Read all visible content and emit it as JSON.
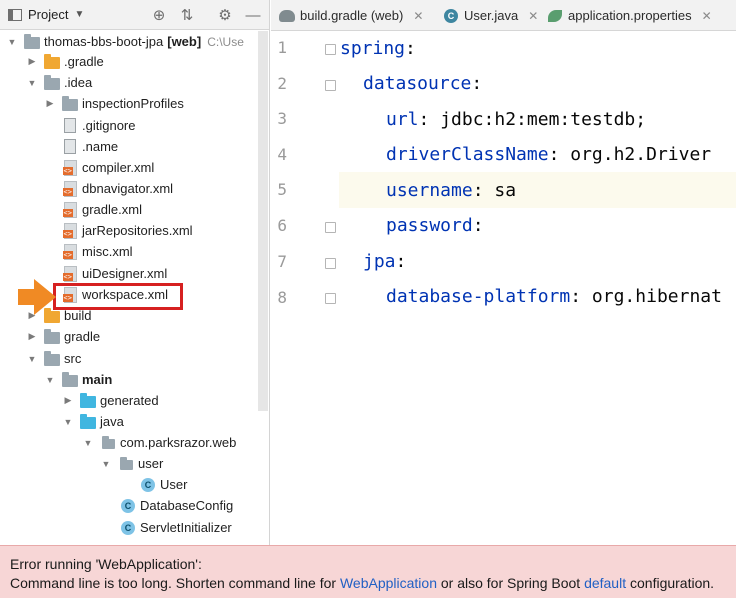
{
  "project_panel": {
    "title": "Project",
    "icons": [
      "project-view-icon",
      "dropdown-caret-icon",
      "locate-icon",
      "collapse-all-icon",
      "gear-icon",
      "hide-icon"
    ],
    "tree": [
      {
        "label": "thomas-bbs-boot-jpa",
        "tag": "[web]",
        "hint": "C:\\Use",
        "icon": "folder-module-icon",
        "expanded": true
      },
      {
        "label": ".gradle",
        "icon": "folder-orange-icon",
        "expanded": false
      },
      {
        "label": ".idea",
        "icon": "folder-icon",
        "expanded": true
      },
      {
        "label": "inspectionProfiles",
        "icon": "folder-icon",
        "expanded": false
      },
      {
        "label": ".gitignore",
        "icon": "ignore-file-icon"
      },
      {
        "label": ".name",
        "icon": "text-file-icon"
      },
      {
        "label": "compiler.xml",
        "icon": "xml-file-icon"
      },
      {
        "label": "dbnavigator.xml",
        "icon": "xml-file-icon"
      },
      {
        "label": "gradle.xml",
        "icon": "xml-file-icon"
      },
      {
        "label": "jarRepositories.xml",
        "icon": "xml-file-icon"
      },
      {
        "label": "misc.xml",
        "icon": "xml-file-icon"
      },
      {
        "label": "uiDesigner.xml",
        "icon": "xml-file-icon"
      },
      {
        "label": "workspace.xml",
        "icon": "xml-file-icon",
        "highlighted": true
      },
      {
        "label": "build",
        "icon": "folder-orange-icon",
        "expanded": false
      },
      {
        "label": "gradle",
        "icon": "folder-icon",
        "expanded": false
      },
      {
        "label": "src",
        "icon": "folder-icon",
        "expanded": true
      },
      {
        "label": "main",
        "icon": "folder-source-root-icon",
        "expanded": true,
        "bold": true
      },
      {
        "label": "generated",
        "icon": "folder-blue-icon",
        "expanded": false
      },
      {
        "label": "java",
        "icon": "folder-blue-icon",
        "expanded": true
      },
      {
        "label": "com.parksrazor.web",
        "icon": "package-icon",
        "expanded": true
      },
      {
        "label": "user",
        "icon": "package-icon",
        "expanded": true
      },
      {
        "label": "User",
        "icon": "class-icon"
      },
      {
        "label": "DatabaseConfig",
        "icon": "class-icon"
      },
      {
        "label": "ServletInitializer",
        "icon": "class-icon"
      }
    ]
  },
  "editor": {
    "tabs": [
      {
        "label": "build.gradle (web)",
        "icon": "gradle-icon"
      },
      {
        "label": "User.java",
        "icon": "class-icon"
      },
      {
        "label": "application.properties",
        "icon": "leaf-icon"
      }
    ],
    "line_numbers": [
      "1",
      "2",
      "3",
      "4",
      "5",
      "6",
      "7",
      "8"
    ],
    "lines": [
      {
        "key": "spring",
        "sep": ":",
        "value": ""
      },
      {
        "key": "datasource",
        "sep": ":",
        "value": ""
      },
      {
        "key": "url",
        "sep": ": ",
        "value": "jdbc:h2:mem:testdb;"
      },
      {
        "key": "driverClassName",
        "sep": ": ",
        "value": "org.h2.Driver"
      },
      {
        "key": "username",
        "sep": ": ",
        "value": "sa"
      },
      {
        "key": "password",
        "sep": ":",
        "value": ""
      },
      {
        "key": "jpa",
        "sep": ":",
        "value": ""
      },
      {
        "key": "database-platform",
        "sep": ": ",
        "value": "org.hibernat"
      }
    ],
    "current_line": "5"
  },
  "error": {
    "title": "Error running 'WebApplication':",
    "message_prefix": "Command line is too long. Shorten command line for ",
    "link1": "WebApplication",
    "message_middle": " or also for Spring Boot ",
    "link2": "default",
    "message_suffix": " configuration."
  },
  "colors": {
    "key": "#0033b3",
    "error_background": "#f7d6d6",
    "highlight_border": "#d62020",
    "arrow": "#f08a24",
    "link": "#2160c4"
  }
}
